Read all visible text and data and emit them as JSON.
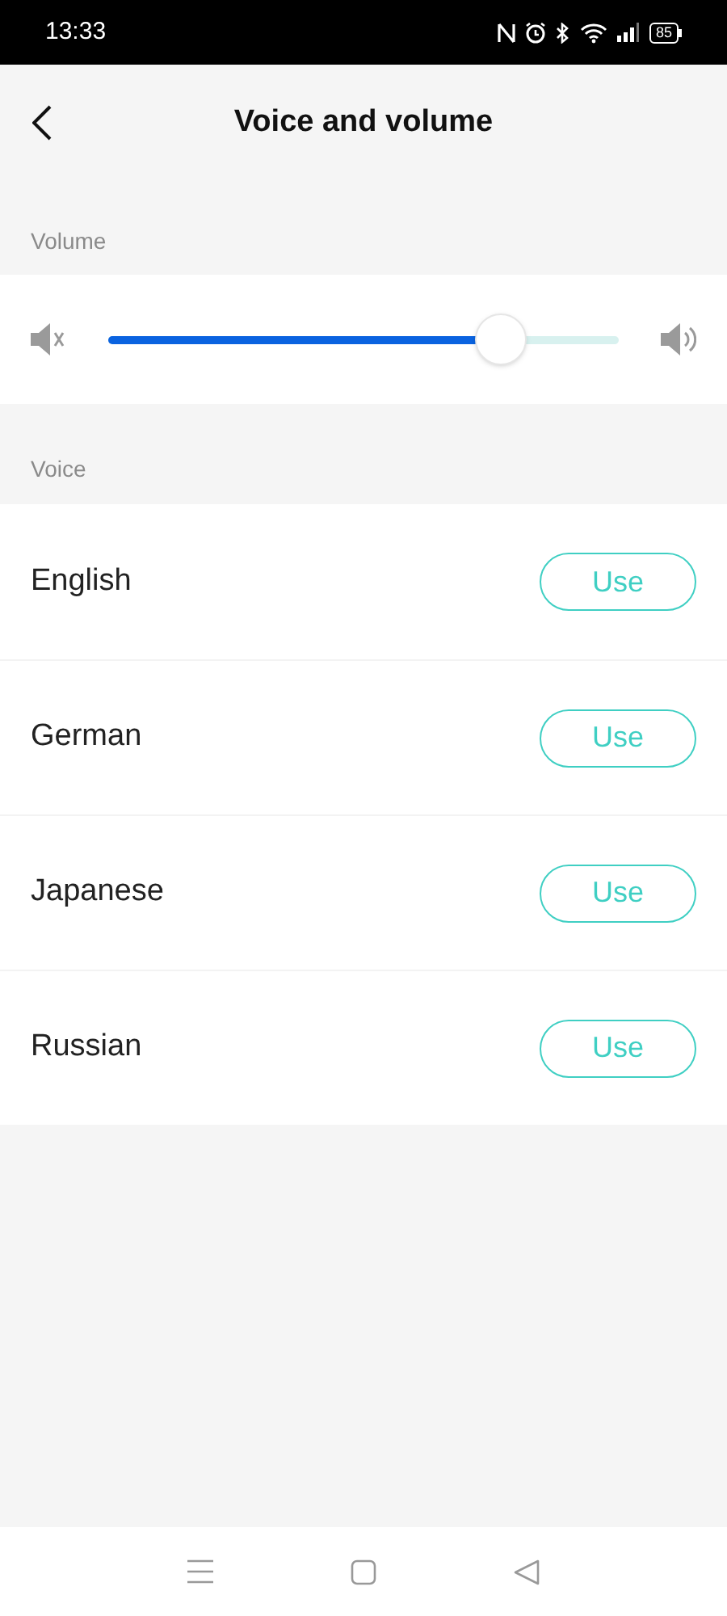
{
  "status_bar": {
    "time": "13:33",
    "battery": "85"
  },
  "header": {
    "title": "Voice and volume"
  },
  "volume": {
    "label": "Volume",
    "level": 0.77
  },
  "voice": {
    "label": "Voice",
    "items": [
      {
        "name": "English",
        "button": "Use"
      },
      {
        "name": "German",
        "button": "Use"
      },
      {
        "name": "Japanese",
        "button": "Use"
      },
      {
        "name": "Russian",
        "button": "Use"
      }
    ]
  }
}
